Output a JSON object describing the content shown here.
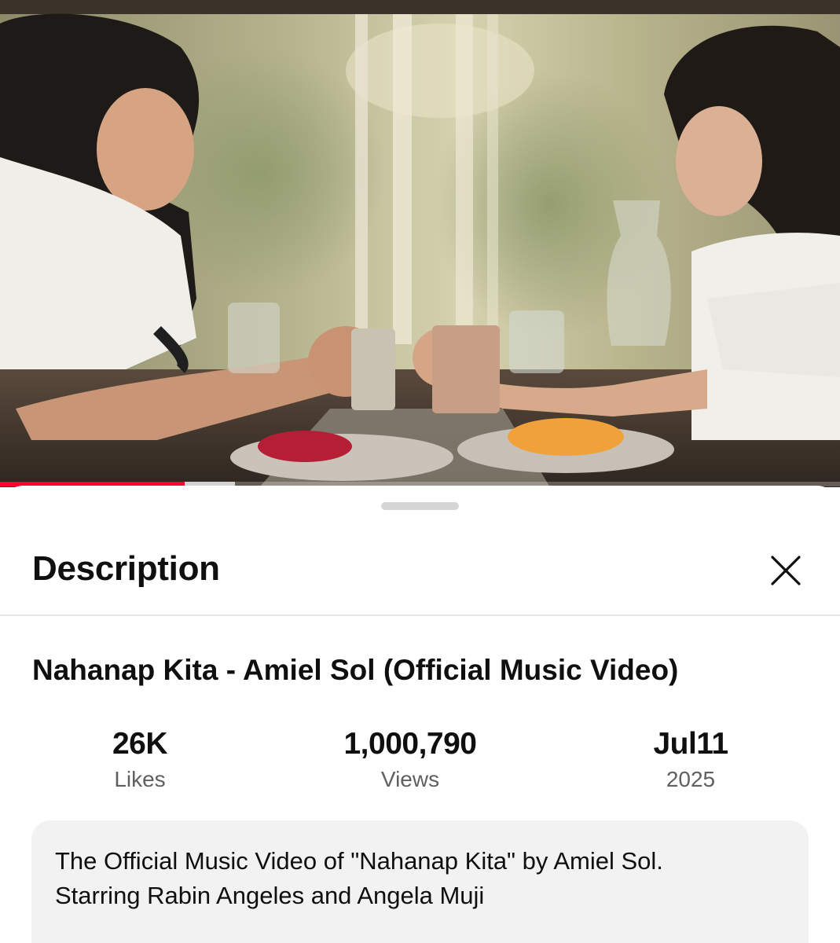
{
  "player": {
    "progress_played": 0.22,
    "progress_buffered": 0.28,
    "progress_color": "#ff0033"
  },
  "sheet": {
    "title": "Description",
    "close_icon": "close-icon"
  },
  "video": {
    "title": "Nahanap Kita - Amiel Sol (Official Music Video)"
  },
  "stats": {
    "likes_value": "26K",
    "likes_label": "Likes",
    "views_value": "1,000,790",
    "views_label": "Views",
    "date_value": "Jul11",
    "date_label": "2025"
  },
  "description": {
    "line1": "The Official Music Video of \"Nahanap Kita\" by Amiel Sol.",
    "line2": "Starring Rabin Angeles and Angela Muji"
  }
}
